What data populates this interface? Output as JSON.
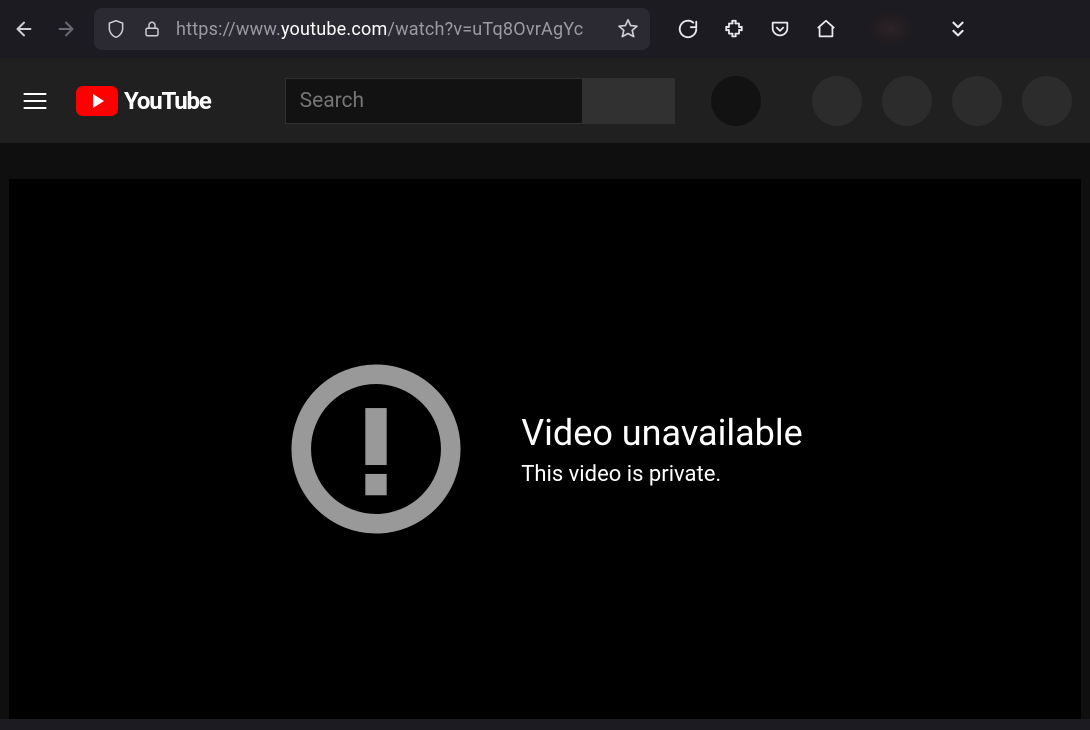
{
  "browser": {
    "url_prefix": "https://www.",
    "url_host": "youtube.com",
    "url_path": "/watch?v=uTq8OvrAgYc"
  },
  "header": {
    "brand": "YouTube",
    "search_placeholder": "Search"
  },
  "error": {
    "title": "Video unavailable",
    "message": "This video is private."
  }
}
